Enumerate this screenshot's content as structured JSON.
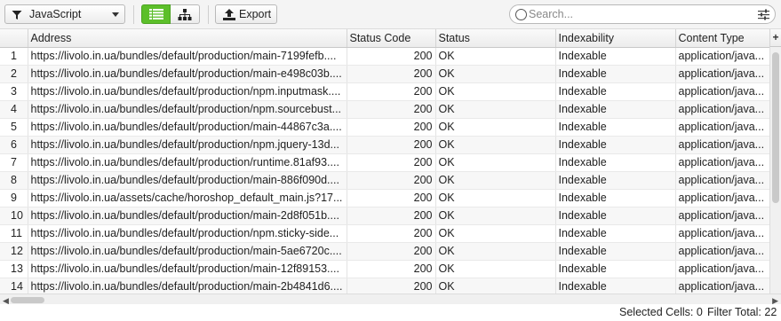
{
  "toolbar": {
    "filter_value": "JavaScript",
    "export_label": "Export",
    "search_placeholder": "Search...",
    "accent_color": "#5cbf2a"
  },
  "table": {
    "columns": [
      "Address",
      "Status Code",
      "Status",
      "Indexability",
      "Content Type"
    ],
    "rows": [
      {
        "n": "1",
        "address": "https://livolo.in.ua/bundles/default/production/main-7199fefb....",
        "code": "200",
        "status": "OK",
        "indexability": "Indexable",
        "type": "application/java..."
      },
      {
        "n": "2",
        "address": "https://livolo.in.ua/bundles/default/production/main-e498c03b....",
        "code": "200",
        "status": "OK",
        "indexability": "Indexable",
        "type": "application/java..."
      },
      {
        "n": "3",
        "address": "https://livolo.in.ua/bundles/default/production/npm.inputmask....",
        "code": "200",
        "status": "OK",
        "indexability": "Indexable",
        "type": "application/java..."
      },
      {
        "n": "4",
        "address": "https://livolo.in.ua/bundles/default/production/npm.sourcebust...",
        "code": "200",
        "status": "OK",
        "indexability": "Indexable",
        "type": "application/java..."
      },
      {
        "n": "5",
        "address": "https://livolo.in.ua/bundles/default/production/main-44867c3a....",
        "code": "200",
        "status": "OK",
        "indexability": "Indexable",
        "type": "application/java..."
      },
      {
        "n": "6",
        "address": "https://livolo.in.ua/bundles/default/production/npm.jquery-13d...",
        "code": "200",
        "status": "OK",
        "indexability": "Indexable",
        "type": "application/java..."
      },
      {
        "n": "7",
        "address": "https://livolo.in.ua/bundles/default/production/runtime.81af93....",
        "code": "200",
        "status": "OK",
        "indexability": "Indexable",
        "type": "application/java..."
      },
      {
        "n": "8",
        "address": "https://livolo.in.ua/bundles/default/production/main-886f090d....",
        "code": "200",
        "status": "OK",
        "indexability": "Indexable",
        "type": "application/java..."
      },
      {
        "n": "9",
        "address": "https://livolo.in.ua/assets/cache/horoshop_default_main.js?17...",
        "code": "200",
        "status": "OK",
        "indexability": "Indexable",
        "type": "application/java..."
      },
      {
        "n": "10",
        "address": "https://livolo.in.ua/bundles/default/production/main-2d8f051b....",
        "code": "200",
        "status": "OK",
        "indexability": "Indexable",
        "type": "application/java..."
      },
      {
        "n": "11",
        "address": "https://livolo.in.ua/bundles/default/production/npm.sticky-side...",
        "code": "200",
        "status": "OK",
        "indexability": "Indexable",
        "type": "application/java..."
      },
      {
        "n": "12",
        "address": "https://livolo.in.ua/bundles/default/production/main-5ae6720c....",
        "code": "200",
        "status": "OK",
        "indexability": "Indexable",
        "type": "application/java..."
      },
      {
        "n": "13",
        "address": "https://livolo.in.ua/bundles/default/production/main-12f89153....",
        "code": "200",
        "status": "OK",
        "indexability": "Indexable",
        "type": "application/java..."
      },
      {
        "n": "14",
        "address": "https://livolo.in.ua/bundles/default/production/main-2b4841d6....",
        "code": "200",
        "status": "OK",
        "indexability": "Indexable",
        "type": "application/java..."
      }
    ]
  },
  "statusbar": {
    "selected_cells_label": "Selected Cells:",
    "selected_cells_value": "0",
    "filter_total_label": "Filter Total:",
    "filter_total_value": "22"
  },
  "icons": {
    "filter": "funnel-icon",
    "list_view": "list-view-icon",
    "tree_view": "tree-view-icon",
    "export": "upload-icon",
    "search": "search-icon",
    "settings": "sliders-icon",
    "add_column": "plus-icon"
  }
}
